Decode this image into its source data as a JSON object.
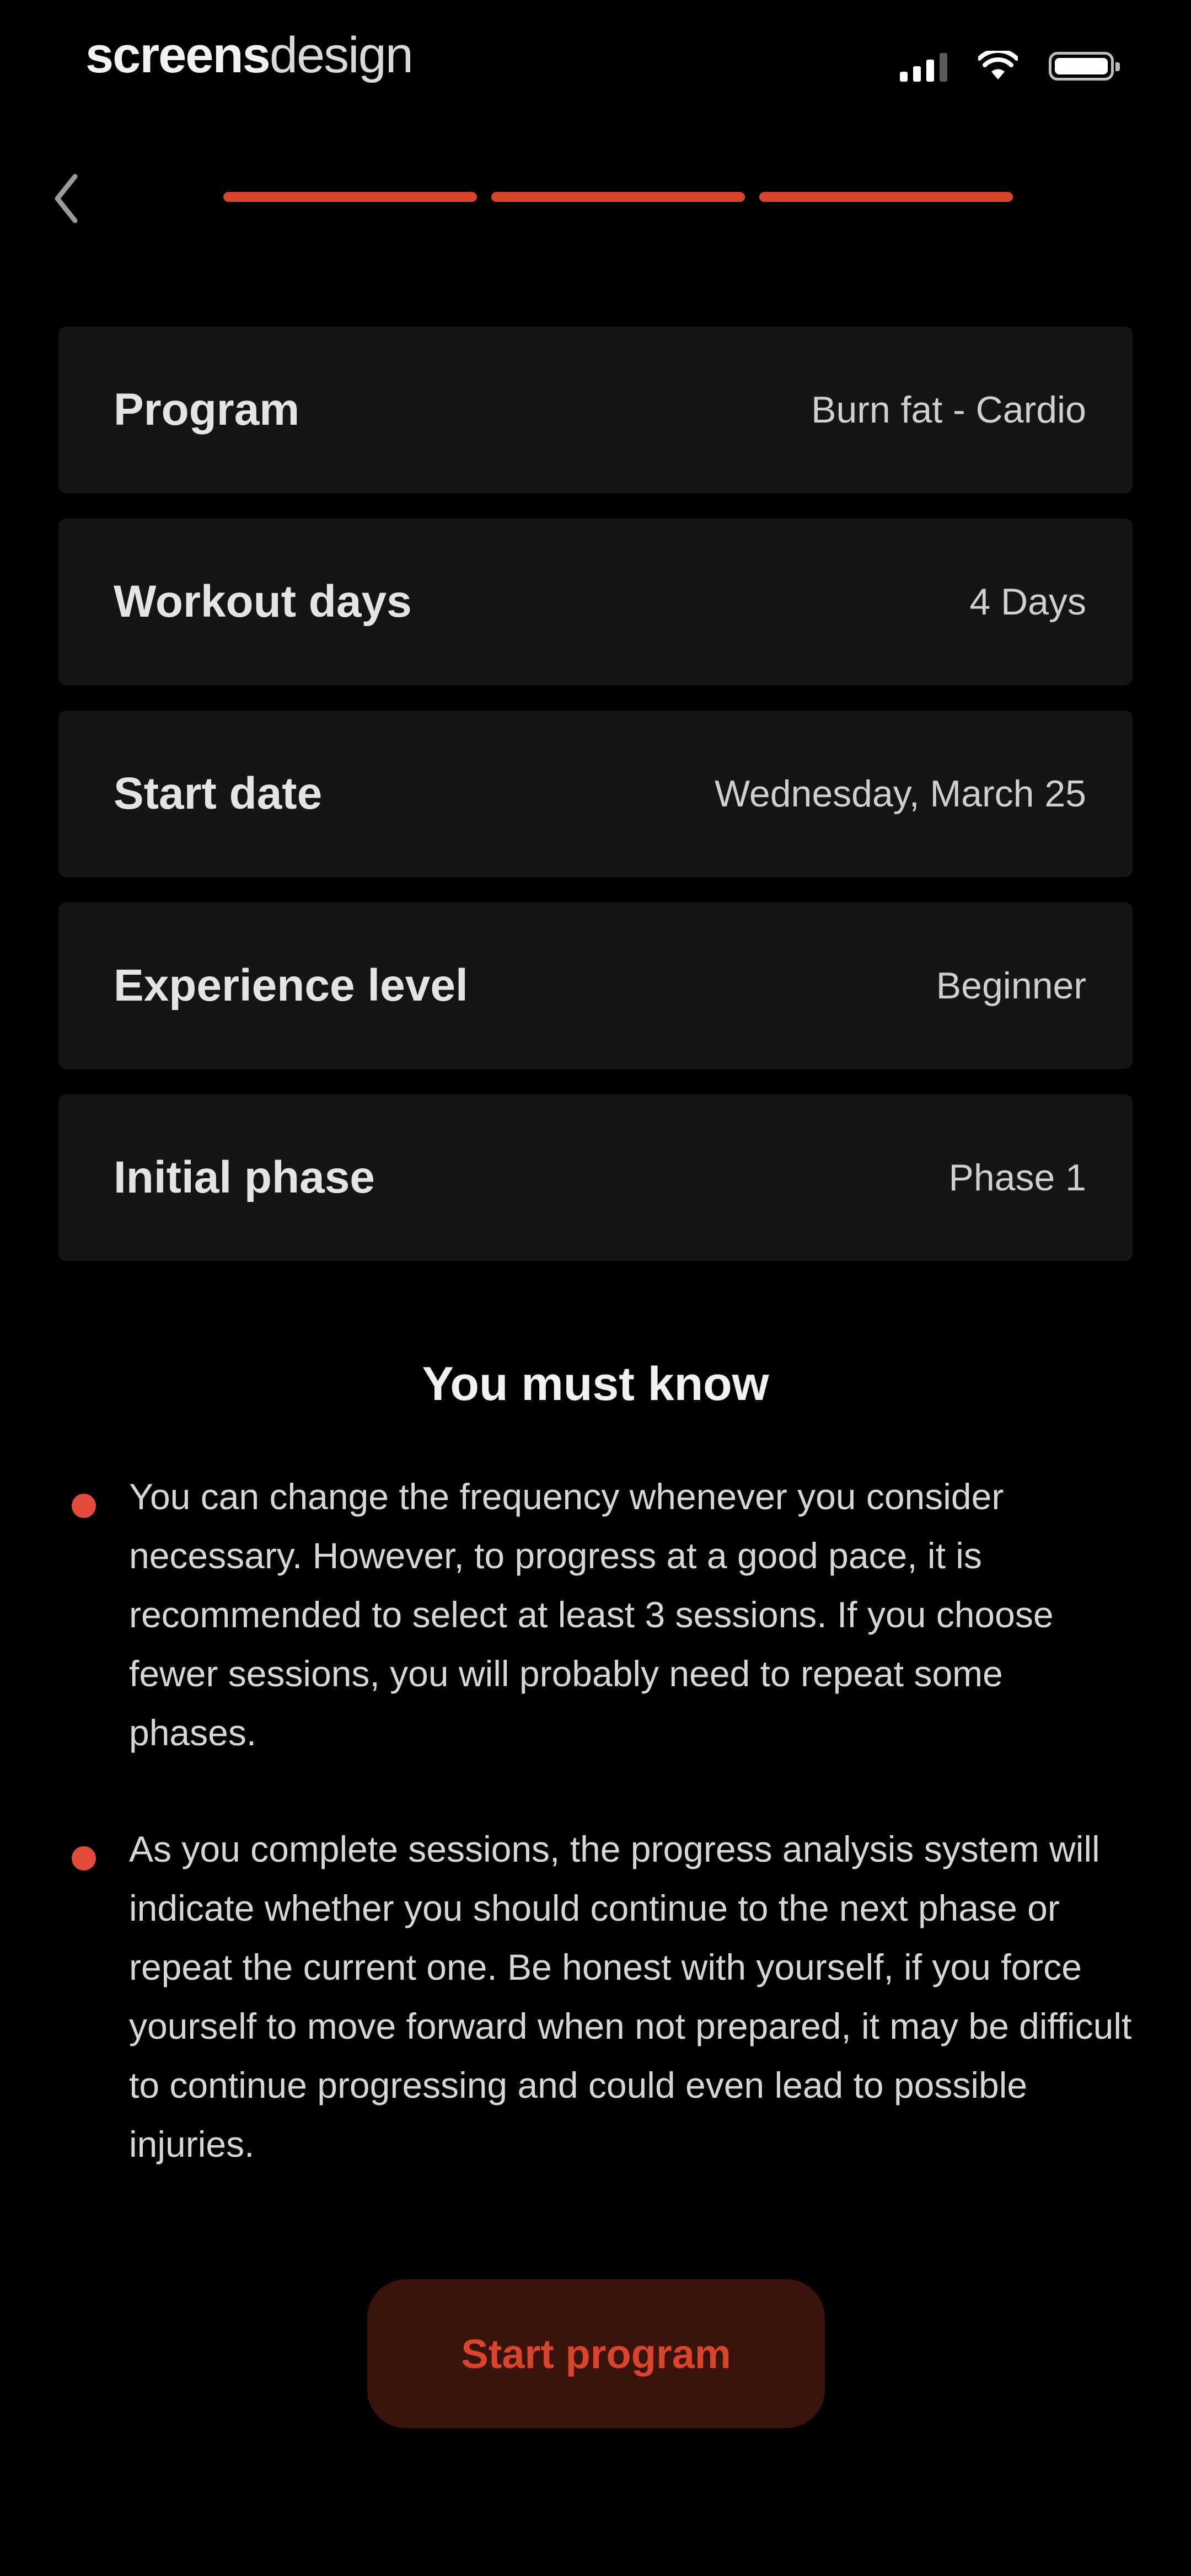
{
  "status_bar": {
    "brand_bold": "screens",
    "brand_regular": "design",
    "signal_icon": "cellular-signal-icon",
    "wifi_icon": "wifi-icon",
    "battery_icon": "battery-icon"
  },
  "nav": {
    "back_icon": "chevron-left-icon",
    "progress_steps_total": 3,
    "progress_steps_completed": 3,
    "accent_color": "#d8452a"
  },
  "summary": {
    "rows": [
      {
        "label": "Program",
        "value": "Burn fat - Cardio"
      },
      {
        "label": "Workout days",
        "value": "4 Days"
      },
      {
        "label": "Start date",
        "value": "Wednesday, March 25"
      },
      {
        "label": "Experience level",
        "value": "Beginner"
      },
      {
        "label": "Initial phase",
        "value": "Phase 1"
      }
    ]
  },
  "you_must_know": {
    "title": "You must know",
    "notes": [
      "You can change the frequency whenever you consider necessary. However, to progress at a good pace, it is recommended to select at least 3 sessions. If you choose fewer sessions, you will probably need to repeat some phases.",
      "As you complete sessions, the progress analysis system will indicate whether you should continue to the next phase or repeat the current one. Be honest with yourself, if you force yourself to move forward when not prepared, it may be difficult to continue progressing and could even lead to possible injuries."
    ]
  },
  "cta": {
    "label": "Start program"
  }
}
